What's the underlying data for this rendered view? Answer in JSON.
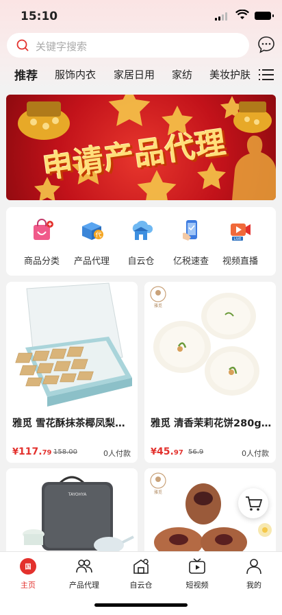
{
  "status": {
    "time": "15:10"
  },
  "search": {
    "placeholder": "关键字搜索"
  },
  "categories": [
    "推荐",
    "服饰内衣",
    "家居日用",
    "家纺",
    "美妆护肤"
  ],
  "banner": {
    "title": "申请产品代理"
  },
  "quick_links": [
    {
      "label": "商品分类",
      "icon": "shopping-bag-icon"
    },
    {
      "label": "产品代理",
      "icon": "box-agent-icon"
    },
    {
      "label": "自云仓",
      "icon": "cloud-warehouse-icon"
    },
    {
      "label": "亿税速查",
      "icon": "tax-phone-icon"
    },
    {
      "label": "视频直播",
      "icon": "live-video-icon"
    }
  ],
  "products": [
    {
      "title": "雅觅 雪花酥抹茶椰凤梨饼...",
      "price_symbol": "¥",
      "price_int": "117.",
      "price_dec": "79",
      "orig_price": "158.00",
      "paid": "0人付款",
      "brand": ""
    },
    {
      "title": "雅觅 清香茉莉花饼280g...",
      "price_symbol": "¥",
      "price_int": "45.",
      "price_dec": "97",
      "orig_price": "56.9",
      "paid": "0人付款",
      "brand": "雅觅"
    },
    {
      "title": "",
      "brand": "TAYOHYA"
    },
    {
      "title": "",
      "brand": "雅觅"
    }
  ],
  "tabs": [
    {
      "label": "主页",
      "icon": "home-icon",
      "active": true
    },
    {
      "label": "产品代理",
      "icon": "users-icon"
    },
    {
      "label": "自云仓",
      "icon": "warehouse-icon"
    },
    {
      "label": "短视频",
      "icon": "tv-play-icon"
    },
    {
      "label": "我的",
      "icon": "person-icon"
    }
  ],
  "colors": {
    "accent": "#e3312d",
    "banner_red": "#c2121a",
    "banner_text": "#ffdf7a"
  }
}
